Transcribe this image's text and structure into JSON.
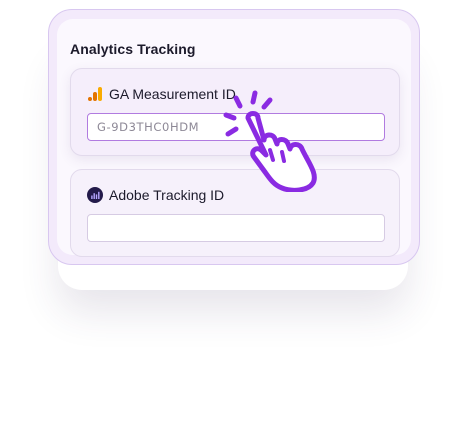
{
  "card": {
    "title": "Analytics Tracking"
  },
  "ga": {
    "label": "GA Measurement ID",
    "value": "G-9D3THC0HDM",
    "icon": "google-analytics-icon"
  },
  "adobe": {
    "label": "Adobe Tracking ID",
    "value": "",
    "icon": "adobe-analytics-icon"
  },
  "pointer": {
    "icon": "tap-hand-icon"
  },
  "colors": {
    "accent": "#8a2be2",
    "ga_orange": "#f9ab00",
    "ga_dark_orange": "#e37400",
    "adobe_dark": "#231a4a",
    "card_border": "#d8c7f0"
  }
}
